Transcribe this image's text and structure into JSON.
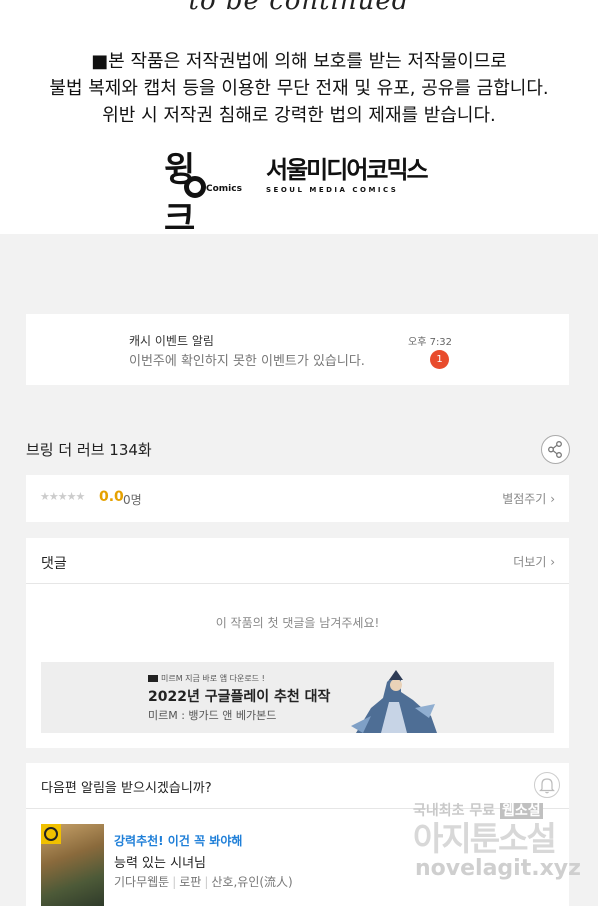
{
  "notice": {
    "to_be_continued": "to be continued",
    "line1": "■본 작품은 저작권법에 의해 보호를 받는 저작물이므로",
    "line2": "불법 복제와 캡처 등을 이용한 무단 전재 및 유포, 공유를 금합니다.",
    "line3": "위반 시 저작권 침해로 강력한 법의 제재를 받습니다.",
    "logo1_main": "윙크",
    "logo1_sub": "Comics",
    "logo2_main": "서울미디어코믹스",
    "logo2_sub": "SEOUL MEDIA COMICS"
  },
  "event": {
    "title": "캐시 이벤트 알림",
    "text": "이번주에 확인하지 못한 이벤트가 있습니다.",
    "time": "오후 7:32",
    "badge": "1"
  },
  "episode": {
    "title": "브링 더 러브 134화"
  },
  "rating": {
    "stars": "★★★★★",
    "score": "0.0",
    "votes": "0명",
    "rate_label": "별점주기"
  },
  "comments": {
    "title": "댓글",
    "more_label": "더보기",
    "empty": "이 작품의 첫 댓글을 남겨주세요!"
  },
  "ad": {
    "brand": "미르M 지금 바로 앱 다운로드 !",
    "title": "2022년 구글플레이 추천 대작",
    "subtitle": "미르M : 뱅가드 앤 베가본드"
  },
  "next": {
    "title": "다음편 알림을 받으시겠습니까?"
  },
  "recommend": {
    "tag": "강력추천! 이건 꼭 봐야해",
    "name": "능력 있는 시녀님",
    "meta1": "기다무웹툰",
    "meta2": "로판",
    "meta3": "산호,유인(流人)"
  },
  "watermark": {
    "top": "국내최초 무료",
    "top_highlight": "웹소설",
    "main": "아지툰소설",
    "url": "novelagit.xyz"
  },
  "colors": {
    "badge": "#e84b2c",
    "score": "#e5a100",
    "tag": "#1f7fd8"
  }
}
